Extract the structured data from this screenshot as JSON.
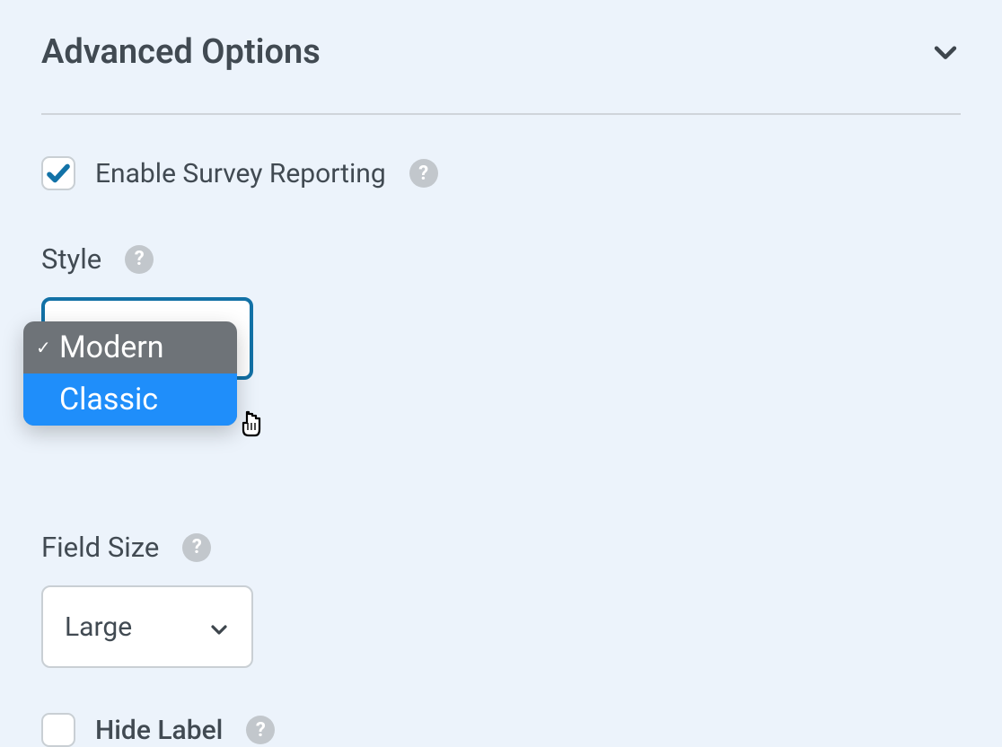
{
  "section": {
    "title": "Advanced Options"
  },
  "options": {
    "enable_survey_reporting": {
      "label": "Enable Survey Reporting",
      "checked": true
    },
    "hide_label": {
      "label": "Hide Label",
      "checked": false
    }
  },
  "style": {
    "label": "Style",
    "options": [
      "Modern",
      "Classic"
    ],
    "selected": "Modern",
    "highlighted": "Classic"
  },
  "field_size": {
    "label": "Field Size",
    "selected": "Large"
  }
}
